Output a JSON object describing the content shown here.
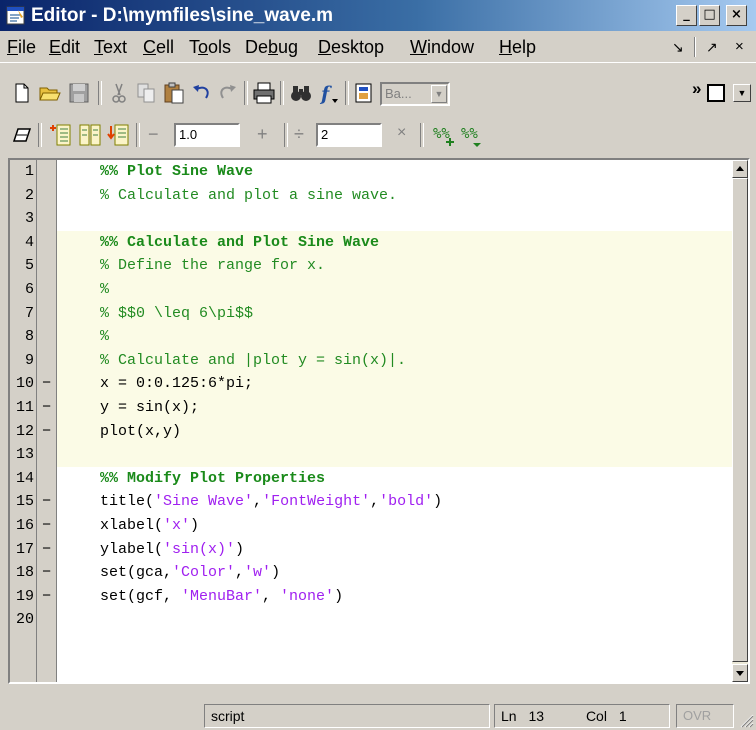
{
  "window": {
    "title": "Editor - D:\\mymfiles\\sine_wave.m",
    "controls": {
      "minimize": "_",
      "restore": "□",
      "close": "×"
    }
  },
  "menubar": {
    "items": [
      {
        "label": "File"
      },
      {
        "label": "Edit"
      },
      {
        "label": "Text"
      },
      {
        "label": "Cell"
      },
      {
        "label": "Tools"
      },
      {
        "label": "Debug"
      },
      {
        "label": "Desktop"
      },
      {
        "label": "Window"
      },
      {
        "label": "Help"
      }
    ],
    "right_controls": [
      "↘",
      "↗",
      "×"
    ]
  },
  "toolbar1": {
    "icons": [
      "new-file-icon",
      "open-file-icon",
      "save-icon",
      "cut-icon",
      "copy-icon",
      "paste-icon",
      "undo-icon",
      "redo-icon",
      "print-icon",
      "find-icon",
      "function-icon",
      "stack-icon"
    ],
    "stack_select": {
      "value": "Ba..."
    },
    "overflow": "»"
  },
  "toolbar2": {
    "icons": [
      "cell-edit-icon",
      "eval-cell-icon",
      "eval-cell-advance-icon",
      "eval-file-icon"
    ],
    "decrement": {
      "label": "−",
      "value": "1.0"
    },
    "increment": {
      "label": "+"
    },
    "divide": {
      "label": "÷",
      "value": "2"
    },
    "multiply": {
      "label": "×"
    },
    "comment_icons": [
      "insert-comment-icon",
      "remove-comment-icon"
    ]
  },
  "editor": {
    "lines": [
      {
        "n": "1",
        "exec": false,
        "parts": [
          {
            "t": "%% Plot Sine Wave",
            "c": "cellttl"
          }
        ]
      },
      {
        "n": "2",
        "exec": false,
        "parts": [
          {
            "t": "% Calculate and plot a sine wave.",
            "c": "cmt"
          }
        ]
      },
      {
        "n": "3",
        "exec": false,
        "parts": []
      },
      {
        "n": "4",
        "exec": false,
        "parts": [
          {
            "t": "%% Calculate and Plot Sine Wave",
            "c": "cellttl"
          }
        ]
      },
      {
        "n": "5",
        "exec": false,
        "parts": [
          {
            "t": "% Define the range for x.",
            "c": "cmt"
          }
        ]
      },
      {
        "n": "6",
        "exec": false,
        "parts": [
          {
            "t": "%",
            "c": "cmt"
          }
        ]
      },
      {
        "n": "7",
        "exec": false,
        "parts": [
          {
            "t": "% $$0 \\leq 6\\pi$$",
            "c": "cmt"
          }
        ]
      },
      {
        "n": "8",
        "exec": false,
        "parts": [
          {
            "t": "%",
            "c": "cmt"
          }
        ]
      },
      {
        "n": "9",
        "exec": false,
        "parts": [
          {
            "t": "% Calculate and |plot y = sin(x)|.",
            "c": "cmt"
          }
        ]
      },
      {
        "n": "10",
        "exec": true,
        "parts": [
          {
            "t": "x = 0:0.125:6*pi;",
            "c": ""
          }
        ]
      },
      {
        "n": "11",
        "exec": true,
        "parts": [
          {
            "t": "y = sin(x);",
            "c": ""
          }
        ]
      },
      {
        "n": "12",
        "exec": true,
        "parts": [
          {
            "t": "plot(x,y)",
            "c": ""
          }
        ]
      },
      {
        "n": "13",
        "exec": false,
        "parts": []
      },
      {
        "n": "14",
        "exec": false,
        "parts": [
          {
            "t": "%% Modify Plot Properties",
            "c": "cellttl"
          }
        ]
      },
      {
        "n": "15",
        "exec": true,
        "parts": [
          {
            "t": "title(",
            "c": ""
          },
          {
            "t": "'Sine Wave'",
            "c": "str"
          },
          {
            "t": ",",
            "c": ""
          },
          {
            "t": "'FontWeight'",
            "c": "str"
          },
          {
            "t": ",",
            "c": ""
          },
          {
            "t": "'bold'",
            "c": "str"
          },
          {
            "t": ")",
            "c": ""
          }
        ]
      },
      {
        "n": "16",
        "exec": true,
        "parts": [
          {
            "t": "xlabel(",
            "c": ""
          },
          {
            "t": "'x'",
            "c": "str"
          },
          {
            "t": ")",
            "c": ""
          }
        ]
      },
      {
        "n": "17",
        "exec": true,
        "parts": [
          {
            "t": "ylabel(",
            "c": ""
          },
          {
            "t": "'sin(x)'",
            "c": "str"
          },
          {
            "t": ")",
            "c": ""
          }
        ]
      },
      {
        "n": "18",
        "exec": true,
        "parts": [
          {
            "t": "set(gca,",
            "c": ""
          },
          {
            "t": "'Color'",
            "c": "str"
          },
          {
            "t": ",",
            "c": ""
          },
          {
            "t": "'w'",
            "c": "str"
          },
          {
            "t": ")",
            "c": ""
          }
        ]
      },
      {
        "n": "19",
        "exec": true,
        "parts": [
          {
            "t": "set(gcf, ",
            "c": ""
          },
          {
            "t": "'MenuBar'",
            "c": "str"
          },
          {
            "t": ", ",
            "c": ""
          },
          {
            "t": "'none'",
            "c": "str"
          },
          {
            "t": ")",
            "c": ""
          }
        ]
      },
      {
        "n": "20",
        "exec": false,
        "parts": []
      }
    ],
    "exec_marker": "−",
    "highlighted_cell_lines": [
      "4",
      "13"
    ]
  },
  "statusbar": {
    "mode": "script",
    "ln_label": "Ln",
    "ln_value": "13",
    "col_label": "Col",
    "col_value": "1",
    "ovr": "OVR"
  }
}
